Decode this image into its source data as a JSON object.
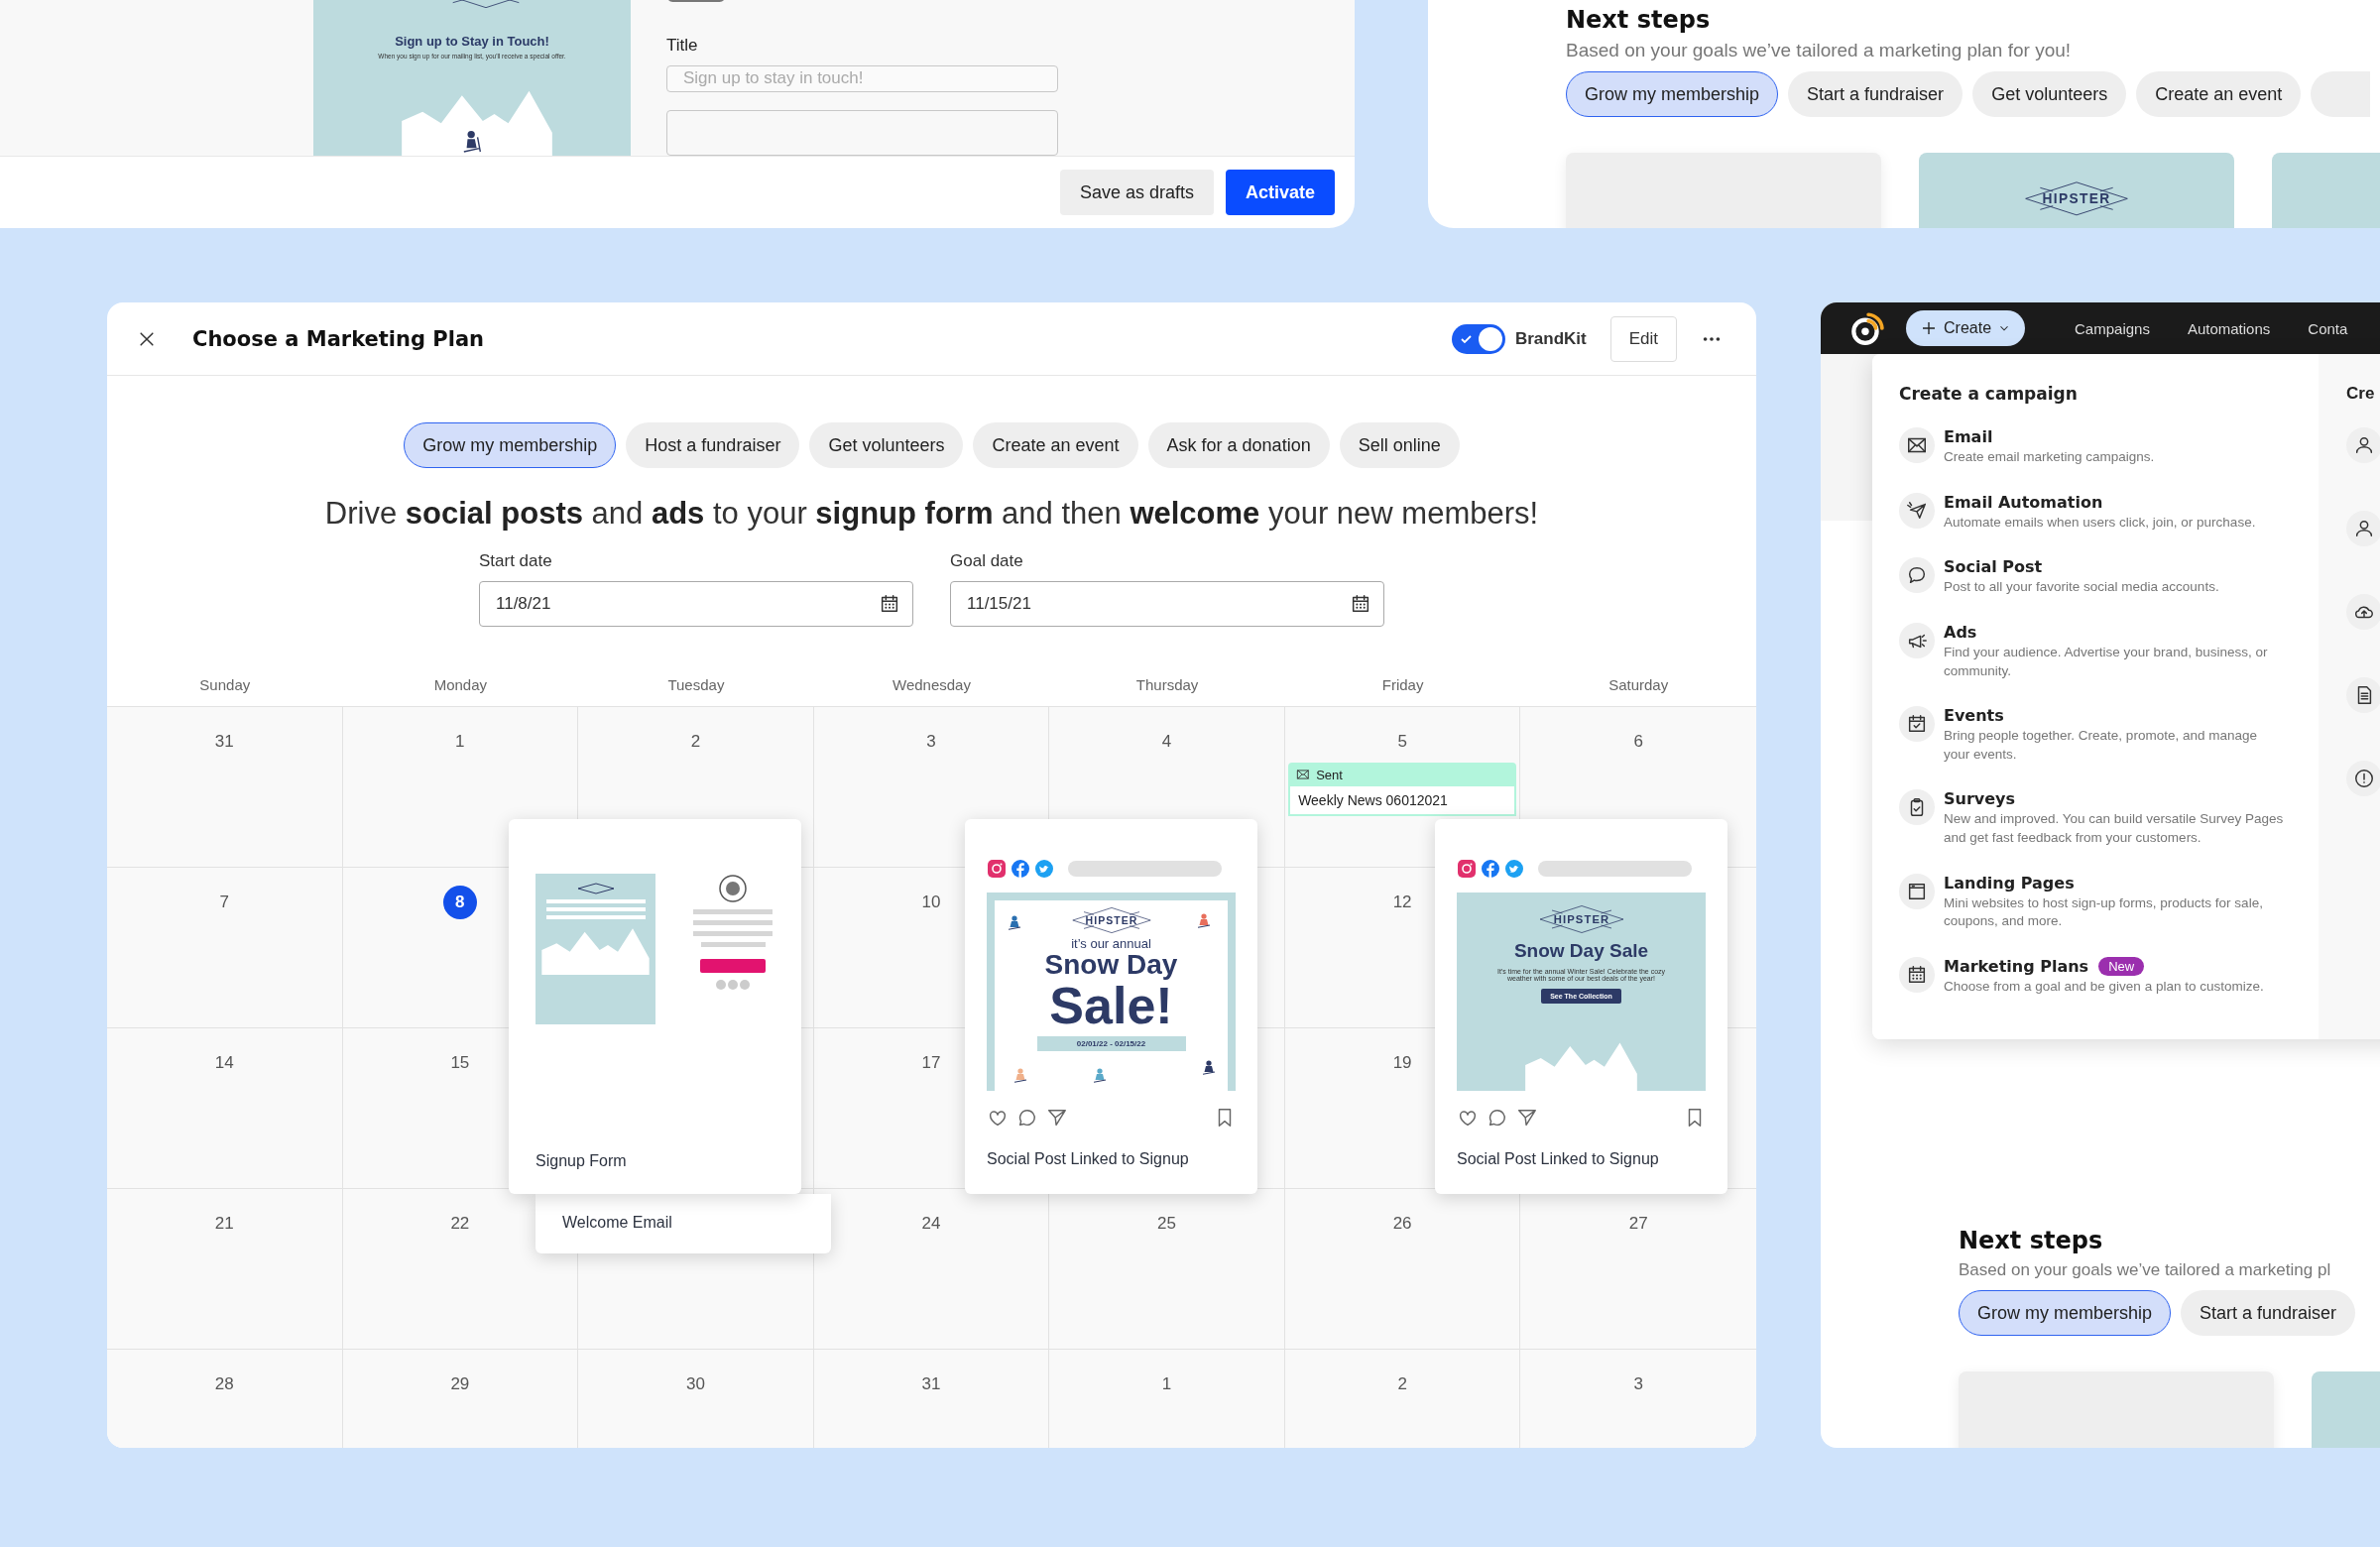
{
  "signup_panel": {
    "preview": {
      "heading": "Sign up to Stay in Touch!",
      "text": "When you sign up for our mailing list, you'll receive a special offer."
    },
    "title_label": "Title",
    "title_field": {
      "placeholder": "Sign up to stay in touch!"
    },
    "buttons": [
      {
        "label": "Save as drafts",
        "kind": "secondary"
      },
      {
        "label": "Activate",
        "kind": "primary"
      }
    ]
  },
  "next_steps_top": {
    "title": "Next steps",
    "subtitle": "Based on your goals we’ve tailored a marketing plan for you!",
    "goals": [
      {
        "label": "Grow my membership",
        "selected": true
      },
      {
        "label": "Start a fundraiser",
        "selected": false
      },
      {
        "label": "Get volunteers",
        "selected": false
      },
      {
        "label": "Create an event",
        "selected": false
      }
    ],
    "cards": [
      {
        "kind": "blank"
      },
      {
        "kind": "logo",
        "logo_text": "HIPSTER"
      },
      {
        "kind": "teal"
      }
    ]
  },
  "marketing_plan": {
    "title": "Choose a Marketing Plan",
    "brandkit": {
      "label": "BrandKit",
      "on": true
    },
    "edit_button": "Edit",
    "goals": [
      {
        "label": "Grow my membership",
        "selected": true
      },
      {
        "label": "Host a fundraiser",
        "selected": false
      },
      {
        "label": "Get volunteers",
        "selected": false
      },
      {
        "label": "Create an event",
        "selected": false
      },
      {
        "label": "Ask for a donation",
        "selected": false
      },
      {
        "label": "Sell online",
        "selected": false
      }
    ],
    "headline": "Drive **social posts** and **ads** to your **signup form** and then **welcome** your new members!",
    "start_date": {
      "label": "Start date",
      "value": "11/8/21"
    },
    "goal_date": {
      "label": "Goal date",
      "value": "11/15/21"
    },
    "weekdays": [
      "Sunday",
      "Monday",
      "Tuesday",
      "Wednesday",
      "Thursday",
      "Friday",
      "Saturday"
    ],
    "weeks": [
      {
        "sunday": {
          "day": "31",
          "today": false
        },
        "monday": {
          "day": "1",
          "today": false
        },
        "tuesday": {
          "day": "2",
          "today": false
        },
        "wednesday": {
          "day": "3",
          "today": false
        },
        "thursday": {
          "day": "4",
          "today": false
        },
        "friday": {
          "day": "5",
          "today": false,
          "event": {
            "status": "Sent",
            "title": "Weekly News 06012021"
          }
        },
        "saturday": {
          "day": "6",
          "today": false
        }
      },
      {
        "sunday": {
          "day": "7",
          "today": false
        },
        "monday": {
          "day": "8",
          "today": true
        },
        "wednesday": {
          "day": "10",
          "today": false
        },
        "friday": {
          "day": "12",
          "today": false
        }
      },
      {
        "sunday": {
          "day": "14",
          "today": false
        },
        "monday": {
          "day": "15",
          "today": false
        },
        "wednesday": {
          "day": "17",
          "today": false
        },
        "friday": {
          "day": "19",
          "today": false
        }
      },
      {
        "sunday": {
          "day": "21",
          "today": false
        },
        "monday": {
          "day": "22",
          "today": false
        },
        "wednesday": {
          "day": "24",
          "today": false
        },
        "thursday": {
          "day": "25",
          "today": false
        },
        "friday": {
          "day": "26",
          "today": false
        },
        "saturday": {
          "day": "27",
          "today": false
        }
      },
      {
        "sunday": {
          "day": "28",
          "today": false
        },
        "monday": {
          "day": "29",
          "today": false
        },
        "tuesday": {
          "day": "30",
          "today": false
        },
        "wednesday": {
          "day": "31",
          "today": false
        },
        "thursday": {
          "day": "1",
          "today": false
        },
        "friday": {
          "day": "2",
          "today": false
        },
        "saturday": {
          "day": "3",
          "today": false
        }
      }
    ],
    "cards": [
      {
        "kind": "email",
        "label": "Welcome Email"
      },
      {
        "kind": "signup_form",
        "label": "Signup Form"
      },
      {
        "kind": "social",
        "label": "Social Post Linked to Signup",
        "image": {
          "kind": "poster",
          "logo_text": "HIPSTER",
          "lead": "it’s our annual",
          "title": "Snow Day",
          "big": "Sale!",
          "dates": "02/01/22 - 02/15/22"
        }
      },
      {
        "kind": "social",
        "label": "Social Post Linked to Signup",
        "image": {
          "kind": "banner",
          "logo_text": "HIPSTER",
          "title": "Snow Day Sale",
          "text": "It’s time for the annual Winter Sale! Celebrate the cozy weather with some of our best deals of the year!",
          "button": "See The Collection"
        }
      }
    ]
  },
  "create_window": {
    "nav": {
      "create_label": "Create",
      "links": [
        "Campaigns",
        "Automations",
        "Conta"
      ]
    },
    "menu": {
      "heading": "Create a campaign",
      "items": [
        {
          "kind": "email",
          "title": "Email",
          "description": "Create email marketing campaigns."
        },
        {
          "kind": "automation",
          "title": "Email Automation",
          "description": "Automate emails when users click, join, or purchase."
        },
        {
          "kind": "social",
          "title": "Social Post",
          "description": "Post to all your favorite social media accounts."
        },
        {
          "kind": "ads",
          "title": "Ads",
          "description": "Find your audience. Advertise your brand, business, or community."
        },
        {
          "kind": "events",
          "title": "Events",
          "description": "Bring people together. Create, promote, and manage your events."
        },
        {
          "kind": "surveys",
          "title": "Surveys",
          "description": "New and improved. You can build versatile Survey Pages and get fast feedback from your customers."
        },
        {
          "kind": "landing",
          "title": "Landing Pages",
          "description": "Mini websites to host sign-up forms, products for sale, coupons, and more."
        },
        {
          "kind": "plans",
          "title": "Marketing Plans",
          "badge": "New",
          "description": "Choose from a goal and be given a plan to customize."
        }
      ],
      "side_heading": "Cre",
      "side_items": [
        {
          "kind": "person"
        },
        {
          "kind": "person"
        },
        {
          "kind": "upload"
        },
        {
          "kind": "document"
        },
        {
          "kind": "alert"
        }
      ]
    },
    "next_steps": {
      "title": "Next steps",
      "subtitle": "Based on your goals we’ve tailored a marketing pl",
      "goals": [
        {
          "label": "Grow my membership",
          "selected": true
        },
        {
          "label": "Start a fundraiser",
          "selected": false
        }
      ],
      "cards": [
        {
          "kind": "blank"
        },
        {
          "kind": "teal"
        }
      ]
    }
  }
}
